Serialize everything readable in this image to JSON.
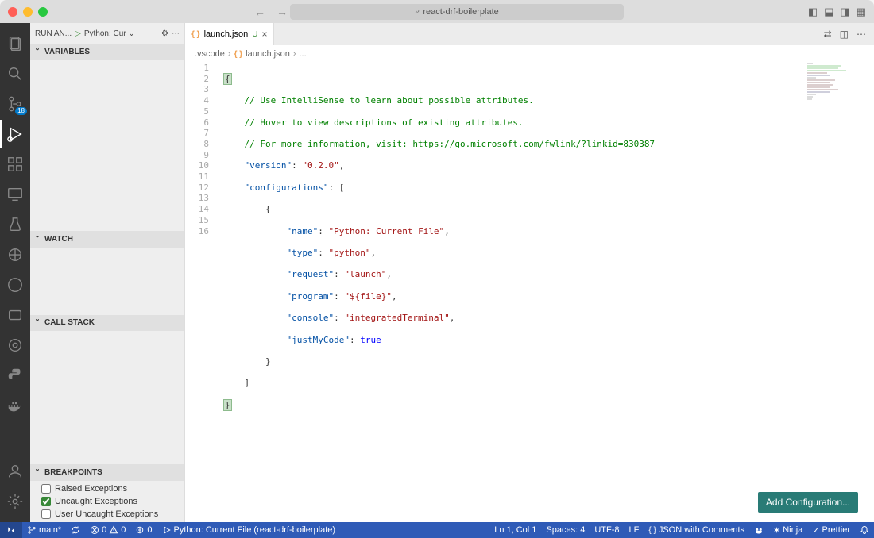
{
  "window": {
    "search_text": "react-drf-boilerplate"
  },
  "sidebar": {
    "run_label": "RUN AN...",
    "config_selected": "Python: Cur",
    "scm_badge": "18",
    "sections": {
      "variables": "VARIABLES",
      "watch": "WATCH",
      "callstack": "CALL STACK",
      "breakpoints": "BREAKPOINTS"
    },
    "breakpoints": [
      {
        "checked": false,
        "label": "Raised Exceptions"
      },
      {
        "checked": true,
        "label": "Uncaught Exceptions"
      },
      {
        "checked": false,
        "label": "User Uncaught Exceptions"
      }
    ]
  },
  "editor": {
    "tab": {
      "filename": "launch.json",
      "dirty_marker": "U"
    },
    "breadcrumb": {
      "folder": ".vscode",
      "file": "launch.json",
      "trail": "..."
    },
    "add_config_btn": "Add Configuration...",
    "code": {
      "comment1": "// Use IntelliSense to learn about possible attributes.",
      "comment2": "// Hover to view descriptions of existing attributes.",
      "comment3": "// For more information, visit: ",
      "comment3_link": "https://go.microsoft.com/fwlink/?linkid=830387",
      "version_key": "\"version\"",
      "version_val": "\"0.2.0\"",
      "configs_key": "\"configurations\"",
      "name_key": "\"name\"",
      "name_val": "\"Python: Current File\"",
      "type_key": "\"type\"",
      "type_val": "\"python\"",
      "request_key": "\"request\"",
      "request_val": "\"launch\"",
      "program_key": "\"program\"",
      "program_val": "\"${file}\"",
      "console_key": "\"console\"",
      "console_val": "\"integratedTerminal\"",
      "justmycode_key": "\"justMyCode\"",
      "justmycode_val": "true"
    },
    "line_numbers": [
      "1",
      "2",
      "3",
      "4",
      "5",
      "6",
      "7",
      "8",
      "9",
      "10",
      "11",
      "12",
      "13",
      "14",
      "15",
      "16"
    ]
  },
  "status": {
    "branch": "main*",
    "sync": "",
    "errors": "0",
    "warnings": "0",
    "ports": "0",
    "debug_label": "Python: Current File (react-drf-boilerplate)",
    "cursor": "Ln 1, Col 1",
    "spaces": "Spaces: 4",
    "encoding": "UTF-8",
    "eol": "LF",
    "language": "JSON with Comments",
    "ninja": "Ninja",
    "prettier": "Prettier"
  }
}
